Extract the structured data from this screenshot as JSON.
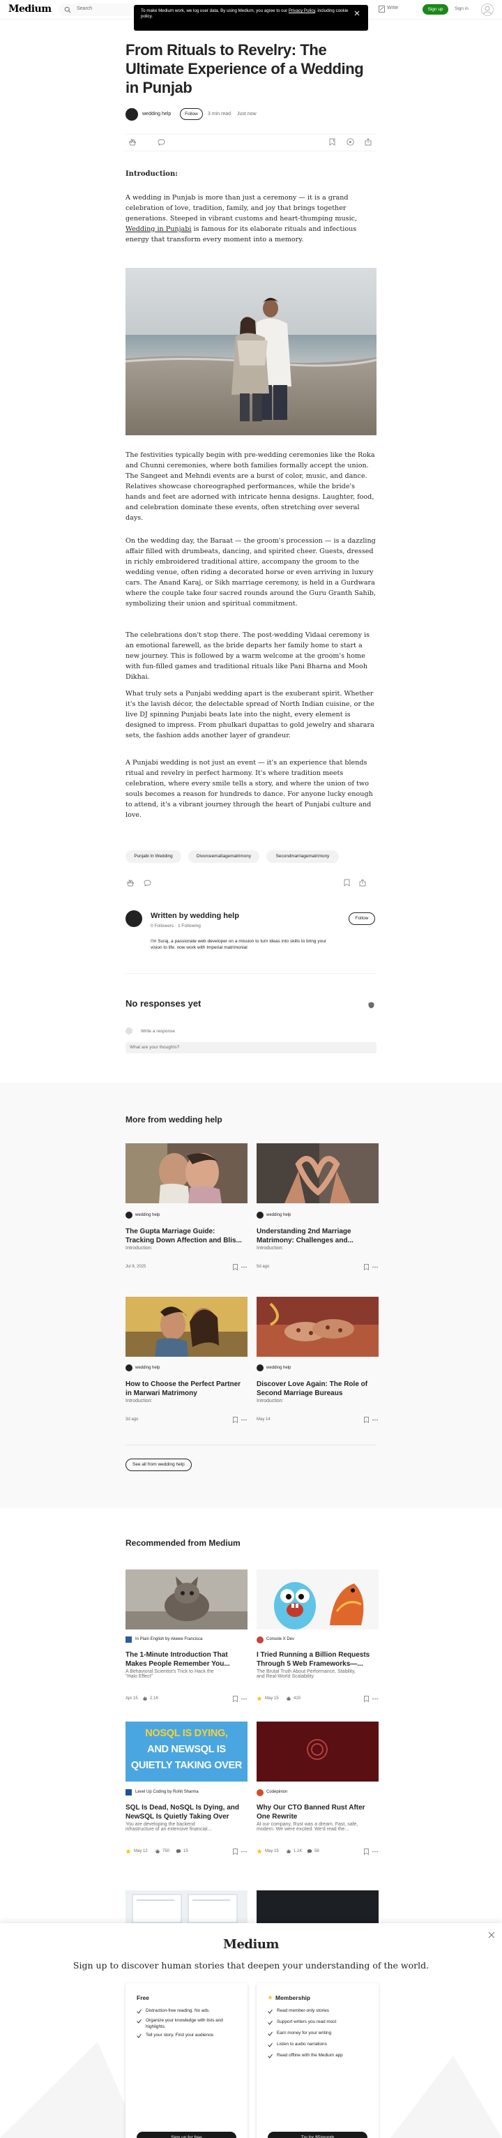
{
  "topbar": {
    "logo": "Medium",
    "search_placeholder": "Search",
    "cookie_line1": "To make Medium work, we log user data. By using Medium, you agree to our",
    "cookie_link": "Privacy Policy",
    "cookie_line2": ", including cookie policy.",
    "write": "Write",
    "sign_up": "Sign up",
    "sign_in": "Sign in"
  },
  "article": {
    "title": "From Rituals to Revelry: The Ultimate Experience of a Wedding in Punjab",
    "author": "wedding help",
    "follow": "Follow",
    "read_time": "3 min read",
    "dot": "·",
    "date": "Just now",
    "intro_heading": "Introduction:",
    "p1_before": "A wedding in Punjab is more than just a ceremony — it is a grand celebration of love, tradition, family, and joy that brings together generations. Steeped in vibrant customs and heart-thumping music,",
    "p1_link": "Wedding in Punjabi",
    "p1_after": "is famous for its elaborate rituals and infectious energy that transform every moment into a memory.",
    "p2": "The festivities typically begin with pre-wedding ceremonies like the Roka and Chunni ceremonies, where both families formally accept the union. The Sangeet and Mehndi events are a burst of color, music, and dance. Relatives showcase choreographed performances, while the bride's hands and feet are adorned with intricate henna designs. Laughter, food, and celebration dominate these events, often stretching over several days.",
    "p3": "On the wedding day, the Baraat — the groom's procession — is a dazzling affair filled with drumbeats, dancing, and spirited cheer. Guests, dressed in richly embroidered traditional attire, accompany the groom to the wedding venue, often riding a decorated horse or even arriving in luxury cars. The Anand Karaj, or Sikh marriage ceremony, is held in a Gurdwara where the couple take four sacred rounds around the Guru Granth Sahib, symbolizing their union and spiritual commitment.",
    "p4": "The celebrations don't stop there. The post-wedding Vidaai ceremony is an emotional farewell, as the bride departs her family home to start a new journey. This is followed by a warm welcome at the groom's home with fun-filled games and traditional rituals like Pani Bharna and Mooh Dikhai.",
    "p5": "What truly sets a Punjabi wedding apart is the exuberant spirit. Whether it's the lavish décor, the delectable spread of North Indian cuisine, or the live DJ spinning Punjabi beats late into the night, every element is designed to impress. From phulkari dupattas to gold jewelry and sharara sets, the fashion adds another layer of grandeur.",
    "p6": "A Punjabi wedding is not just an event — it's an experience that blends ritual and revelry in perfect harmony. It's where tradition meets celebration, where every smile tells a story, and where the union of two souls becomes a reason for hundreds to dance. For anyone lucky enough to attend, it's a vibrant journey through the heart of Punjabi culture and love.",
    "tags": [
      "Punjabi In Wedding",
      "Divorceemattagematrimony",
      "Secondmarriagematrimony"
    ]
  },
  "author_box": {
    "written_by": "Written by wedding help",
    "followers": "0 Followers",
    "following": "1 Following",
    "bio": "I'm Suraj, a passionate web developer on a mission to turn ideas into skills to bring your vision to life. now work with Imperial matrimonial",
    "follow": "Follow"
  },
  "responses": {
    "heading": "No responses yet",
    "write_label": "Write a response",
    "placeholder": "What are your thoughts?"
  },
  "more_from": {
    "heading": "More from wedding help",
    "cards": [
      {
        "author": "wedding help",
        "title1": "The Gupta Marriage Guide:",
        "title2": "Tracking Down Affection and Blis...",
        "sub": "Introduction:",
        "date": "Jul 8, 2025"
      },
      {
        "author": "wedding help",
        "title1": "Understanding 2nd Marriage",
        "title2": "Matrimony: Challenges and...",
        "sub": "Introduction:",
        "date": "5d ago"
      },
      {
        "author": "wedding help",
        "title1": "How to Choose the Perfect Partner",
        "title2": "in Marwari Matrimony",
        "sub": "Introduction:",
        "date": "3d ago"
      },
      {
        "author": "wedding help",
        "title1": "Discover Love Again: The Role of",
        "title2": "Second Marriage Bureaus",
        "sub": "Introduction:",
        "date": "May 14"
      }
    ],
    "see_all": "See all from wedding help"
  },
  "recommended": {
    "heading": "Recommended from Medium",
    "cards": [
      {
        "author": "In Plain English by Akewe Francisca",
        "title1": "The 1-Minute Introduction That",
        "title2": "Makes People Remember You...",
        "sub1": "A Behavioral Scientist's Trick to Hack the",
        "sub2": "\"Halo Effect\"",
        "date": "Apr 15",
        "claps": "2.1K",
        "comments": "",
        "starred": false
      },
      {
        "author": "Console X Dev",
        "title1": "I Tried Running a Billion Requests",
        "title2": "Through 5 Web Frameworks—...",
        "sub1": "The Brutal Truth About Performance, Stability,",
        "sub2": "and Real-World Scalability",
        "date": "May 15",
        "claps": "415",
        "comments": "",
        "starred": true
      },
      {
        "author": "Level Up Coding by Rohit Sharma",
        "title1": "SQL Is Dead, NoSQL Is Dying, and",
        "title2": "NewSQL Is Quietly Taking Over",
        "sub1": "You are developing the backend",
        "sub2": "infrastructure of an extensive financial...",
        "date": "May 12",
        "claps": "750",
        "comments": "15",
        "starred": true
      },
      {
        "author": "Codepinion",
        "title1": "Why Our CTO Banned Rust After",
        "title2": "One Rewrite",
        "sub1": "At our company, Rust was a dream. Fast, safe,",
        "sub2": "modern. We were excited. We'd read the...",
        "date": "May 15",
        "claps": "1.1K",
        "comments": "58",
        "starred": true
      }
    ],
    "nosql_banner": [
      "NOSQL IS DYING,",
      "AND NEWSQL IS",
      "QUIETLY TAKING OVER"
    ]
  },
  "signup_modal": {
    "logo": "Medium",
    "headline": "Sign up to discover human stories that deepen your understanding of the world.",
    "free": {
      "title": "Free",
      "items": [
        "Distraction-free reading. No ads.",
        "Organize your knowledge with lists and highlights.",
        "Tell your story. Find your audience."
      ],
      "button": "Sign up for free"
    },
    "membership": {
      "title": "Membership",
      "items": [
        "Read member-only stories",
        "Support writers you read most",
        "Earn money for your writing",
        "Listen to audio narrations",
        "Read offline with the Medium app"
      ],
      "button": "Try for $5/month"
    }
  },
  "colors": {
    "brand_green": "#1a8917",
    "star": "#ffc017",
    "text": "#242424",
    "muted": "#6b6b6b"
  }
}
